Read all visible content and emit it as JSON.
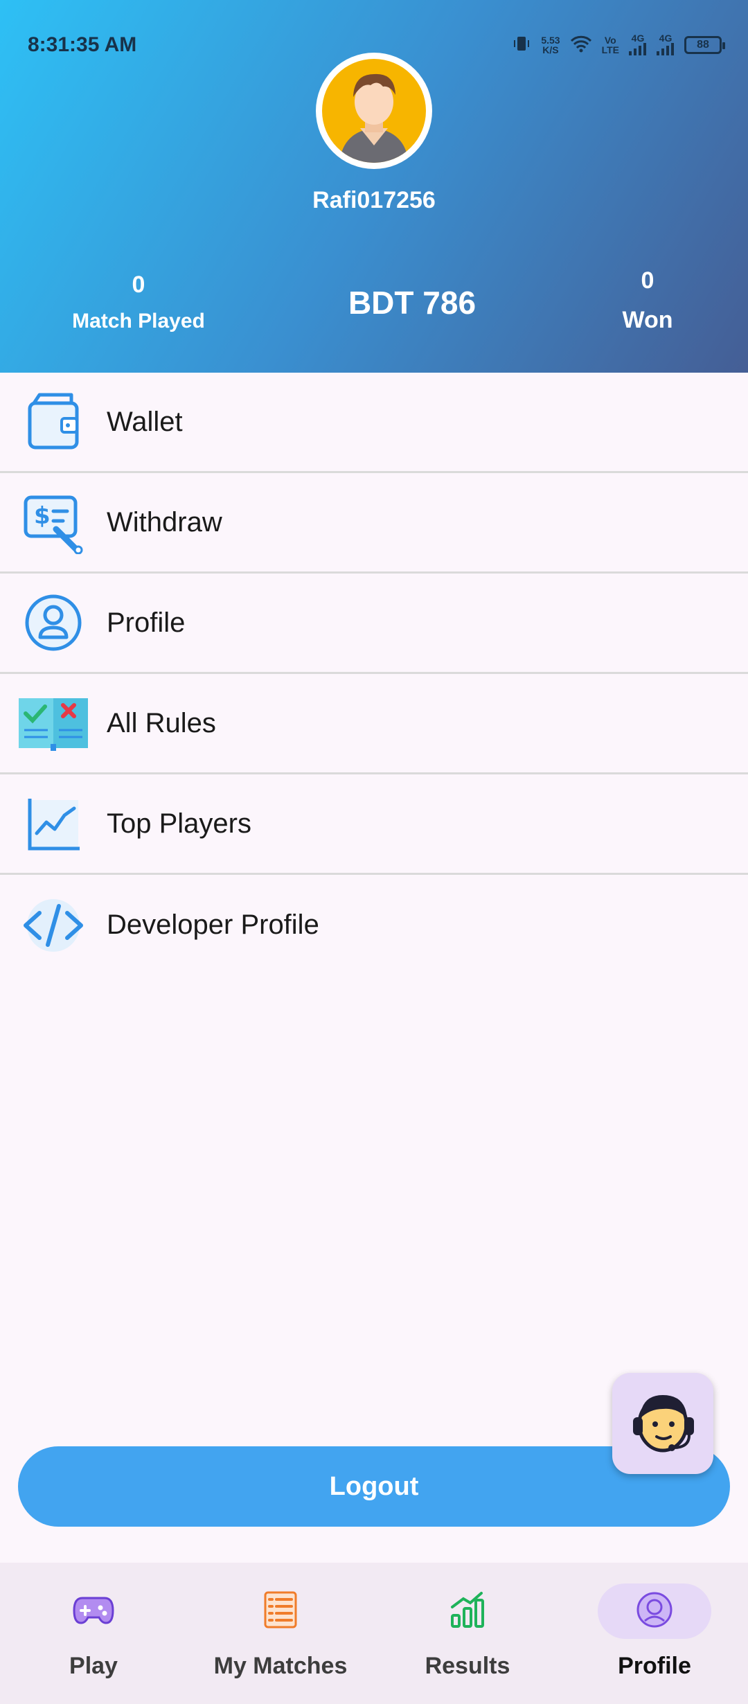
{
  "status_bar": {
    "time": "8:31:35 AM",
    "net_speed_value": "5.53",
    "net_speed_unit": "K/S",
    "volte_top": "Vo",
    "volte_bottom": "LTE",
    "signal1_label": "4G",
    "signal2_label": "4G",
    "battery": "88"
  },
  "profile": {
    "username": "Rafi017256",
    "matches_played_value": "0",
    "matches_played_label": "Match Played",
    "balance": "BDT 786",
    "won_value": "0",
    "won_label": "Won"
  },
  "menu": {
    "items": [
      {
        "label": "Wallet",
        "icon": "wallet-icon"
      },
      {
        "label": "Withdraw",
        "icon": "withdraw-icon"
      },
      {
        "label": "Profile",
        "icon": "user-circle-icon"
      },
      {
        "label": "All Rules",
        "icon": "rules-book-icon"
      },
      {
        "label": "Top Players",
        "icon": "chart-trend-icon"
      },
      {
        "label": "Developer Profile",
        "icon": "code-icon"
      }
    ]
  },
  "logout_label": "Logout",
  "bottom_nav": {
    "items": [
      {
        "label": "Play",
        "icon": "gamepad-icon"
      },
      {
        "label": "My Matches",
        "icon": "list-icon"
      },
      {
        "label": "Results",
        "icon": "bar-chart-icon"
      },
      {
        "label": "Profile",
        "icon": "profile-icon",
        "active": true
      }
    ]
  },
  "colors": {
    "header_gradient_start": "#2ec0f5",
    "header_gradient_end": "#455e95",
    "primary_button": "#42a4f0",
    "active_tab_bg": "#e6d9f7"
  }
}
